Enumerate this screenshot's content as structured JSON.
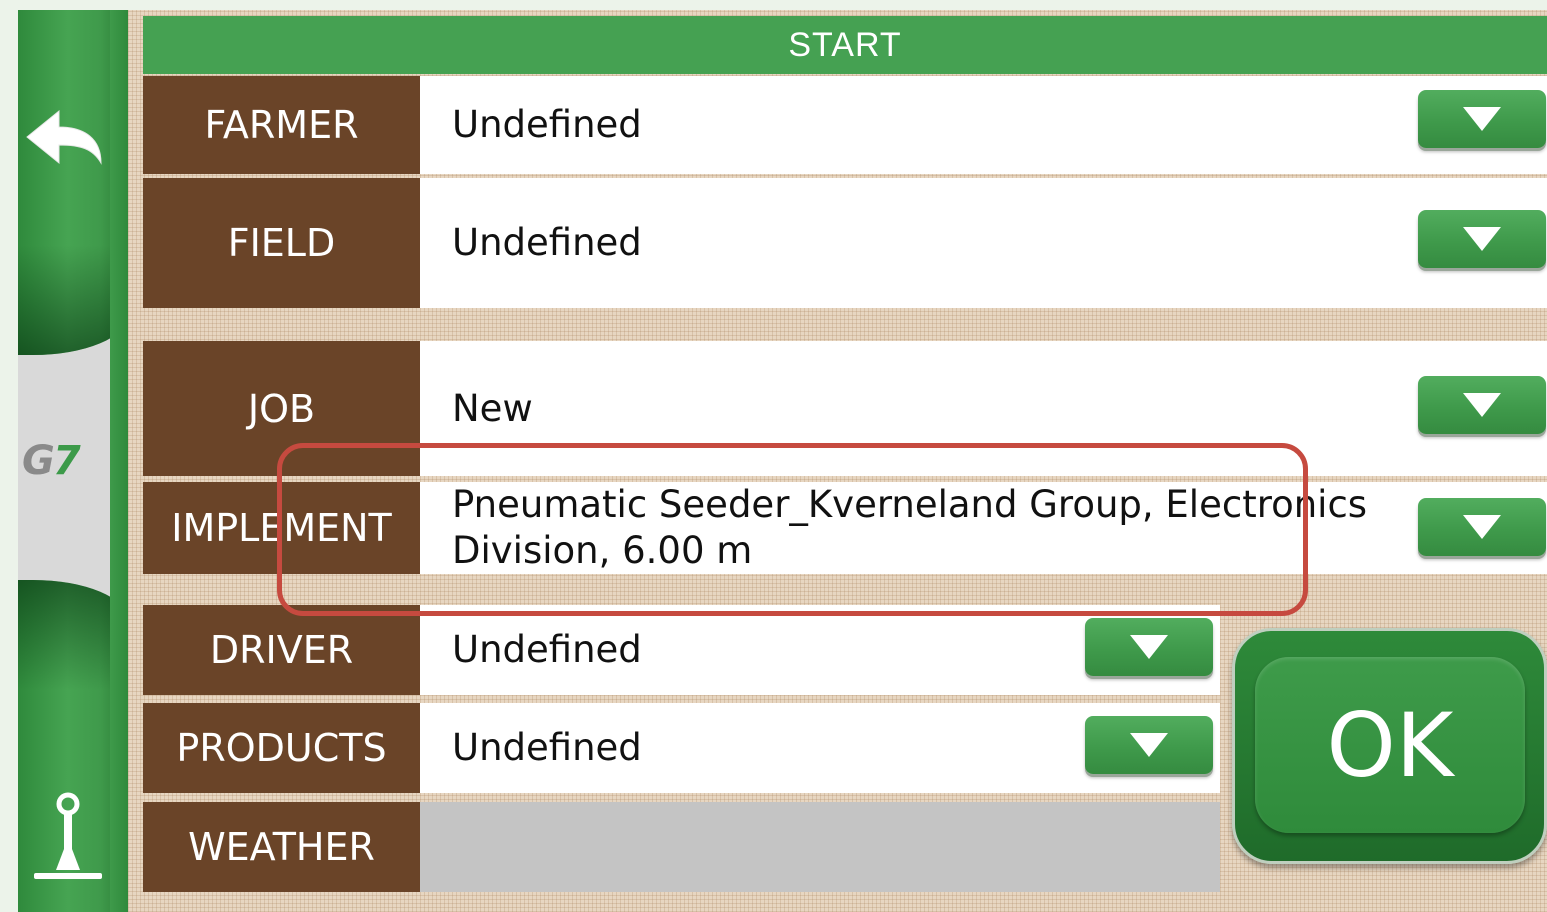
{
  "header": {
    "title": "START"
  },
  "rows": [
    {
      "label": "FARMER",
      "value": "Undefined"
    },
    {
      "label": "FIELD",
      "value": "Undefined"
    },
    {
      "label": "JOB",
      "value": "New"
    },
    {
      "label": "IMPLEMENT",
      "value_line1": "Pneumatic Seeder_Kverneland Group, Electronics",
      "value_line2": "Division, 6.00 m"
    },
    {
      "label": "DRIVER",
      "value": "Undefined"
    },
    {
      "label": "PRODUCTS",
      "value": "Undefined"
    },
    {
      "label": "WEATHER",
      "value": ""
    }
  ],
  "ok_button": {
    "label": "OK"
  },
  "sidebar": {
    "logo_text_g": "G",
    "logo_text_7": "7",
    "icons": [
      "back-arrow-icon",
      "joystick-icon"
    ]
  },
  "colors": {
    "green": "#45a152",
    "brown": "#6a4428",
    "highlight": "#c64a3f"
  }
}
